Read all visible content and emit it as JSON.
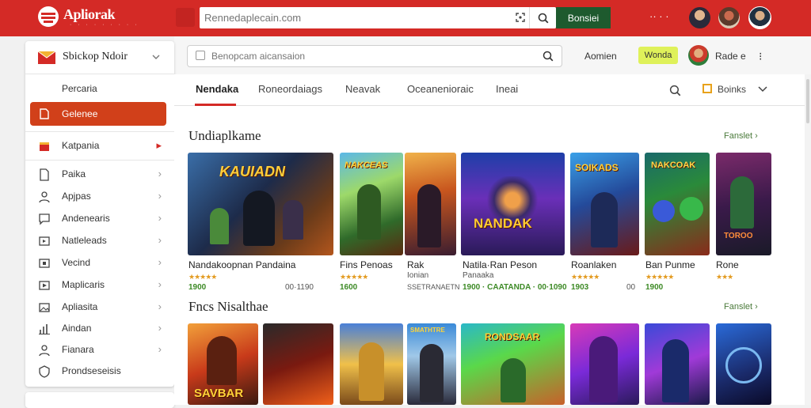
{
  "app": {
    "brand": "Apliorak",
    "brand_sub": "· · · · · · · · ·"
  },
  "topbar": {
    "search_placeholder": "Rennedaplecain.com",
    "submit_label": "Bonsiei",
    "extra_text": "·· · ·"
  },
  "sidebar": {
    "title": "Sbickop Ndoir",
    "items": [
      {
        "label": "Percaria"
      },
      {
        "label": "Gelenee"
      },
      {
        "label": "Katpania"
      },
      {
        "label": "Paika"
      },
      {
        "label": "Apjpas"
      },
      {
        "label": "Andenearis"
      },
      {
        "label": "Natleleads"
      },
      {
        "label": "Vecind"
      },
      {
        "label": "Maplicaris"
      },
      {
        "label": "Apliasita"
      },
      {
        "label": "Aindan"
      },
      {
        "label": "Fianara"
      },
      {
        "label": "Prondseseisis"
      }
    ]
  },
  "subbar": {
    "search_placeholder": "Benopcam aicansaion",
    "account_label": "Aomien",
    "button_label": "Wonda",
    "user_label": "Rade e",
    "more_label": "⁝"
  },
  "tabs": [
    {
      "label": "Nendaka"
    },
    {
      "label": "Roneordaiags"
    },
    {
      "label": "Neavak"
    },
    {
      "label": "Oceanenioraic"
    },
    {
      "label": "Ineai"
    }
  ],
  "tabs_right": {
    "label": "Boinks"
  },
  "sections": [
    {
      "title": "Undiaplkame",
      "see_all": "Fanslet",
      "cards": [
        {
          "name": "Nandakoopnan Pandaina",
          "stars": "★★★★★",
          "meta1": "1900",
          "meta2": "00·1190",
          "art_text": "KAUIADN"
        },
        {
          "name": "Fins Penoas",
          "stars": "★★★★★",
          "meta1": "1600",
          "meta2": "",
          "art_text": "NAKCEAS"
        },
        {
          "name": "Rak",
          "stars": "",
          "meta1": "Ionian",
          "meta2": "SSETRANAETN",
          "art_text": ""
        },
        {
          "name": "Natila·Ran Peson",
          "stars": "",
          "meta1": "Panaaka",
          "meta2": "1900 · CAATANDA · 00·1090",
          "art_text": "NANDAK"
        },
        {
          "name": "Roanlaken",
          "stars": "★★★★★",
          "meta1": "1903",
          "meta2": "00",
          "art_text": "SOIKADS"
        },
        {
          "name": "Ban Punme",
          "stars": "★★★★★",
          "meta1": "1900",
          "meta2": "",
          "art_text": "NAKCOAK"
        },
        {
          "name": "Rone",
          "stars": "★★★",
          "meta1": "",
          "meta2": "",
          "art_text": "TOROO"
        }
      ]
    },
    {
      "title": "Fncs Nisalthae",
      "see_all": "Fanslet",
      "cards": [
        {
          "art_text": "SAVBAR"
        },
        {
          "art_text": ""
        },
        {
          "art_text": ""
        },
        {
          "art_text": "SMATHTRE"
        },
        {
          "art_text": "RONDSAAR"
        },
        {
          "art_text": ""
        },
        {
          "art_text": ""
        },
        {
          "art_text": ""
        }
      ]
    }
  ],
  "colors": {
    "brand_red": "#d42a26",
    "active_orange": "#d1401a",
    "submit_green": "#1e5a2e",
    "highlight_yellow": "#dff15a",
    "rating_gold": "#e39b21",
    "meta_green": "#3d8a26"
  },
  "icons": [
    "logo-icon",
    "scan-icon",
    "search-icon",
    "chevron-right-icon",
    "chevron-down-icon",
    "box-icon",
    "more-icon"
  ]
}
